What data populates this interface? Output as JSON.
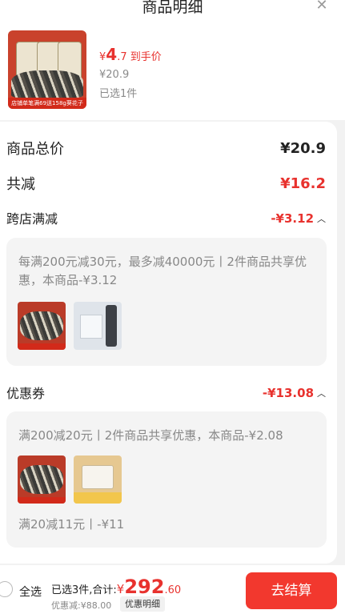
{
  "header": {
    "title": "商品明细",
    "close_icon": "close-icon"
  },
  "product": {
    "thumb_banner": "店铺单笔满69送158g葵花子",
    "hand_price_currency": "¥",
    "hand_price_int": "4",
    "hand_price_dec": ".7",
    "hand_price_label": "到手价",
    "original_price": "¥20.9",
    "selected": "已选1件"
  },
  "summary": {
    "total_label": "商品总价",
    "total_value": "¥20.9",
    "reduce_label": "共减",
    "reduce_value": "¥16.2"
  },
  "cross_store": {
    "label": "跨店满减",
    "value": "-¥3.12",
    "text": "每满200元减30元，最多减40000元丨2件商品共享优惠，本商品-¥3.12"
  },
  "coupon": {
    "label": "优惠券",
    "value": "-¥13.08",
    "text_1": "满200减20元丨2件商品共享优惠，本商品-¥2.08",
    "text_2": "满20减11元丨-¥11"
  },
  "bottom": {
    "select_all": "全选",
    "selected_summary": "已选3件,合计:",
    "currency": "¥",
    "total_int": "292",
    "total_dec": ".60",
    "discount": "优惠减:¥88.00",
    "detail_button": "优惠明细",
    "checkout_button": "去结算"
  },
  "colors": {
    "accent": "#e8322e",
    "button": "#f2382e"
  }
}
